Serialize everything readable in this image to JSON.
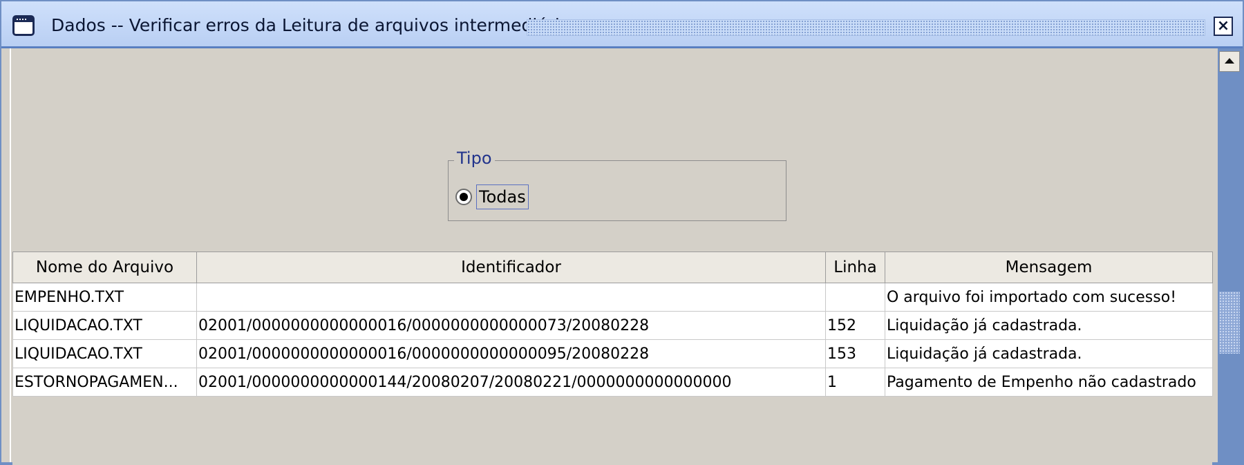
{
  "window": {
    "title": "Dados -- Verificar erros da Leitura de arquivos intermediários",
    "close_glyph": "×"
  },
  "filter": {
    "group_label": "Tipo",
    "option_label": "Todas",
    "selected": true
  },
  "table": {
    "columns": [
      "Nome do Arquivo",
      "Identificador",
      "Linha",
      "Mensagem"
    ],
    "rows": [
      [
        "EMPENHO.TXT",
        "",
        "",
        "O arquivo foi importado com sucesso!"
      ],
      [
        "LIQUIDACAO.TXT",
        "02001/0000000000000016/0000000000000073/20080228",
        "152",
        "Liquidação já cadastrada."
      ],
      [
        "LIQUIDACAO.TXT",
        "02001/0000000000000016/0000000000000095/20080228",
        "153",
        "Liquidação já cadastrada."
      ],
      [
        "ESTORNOPAGAMEN...",
        "02001/0000000000000144/20080207/20080221/0000000000000000",
        "1",
        "Pagamento de Empenho não cadastrado"
      ]
    ]
  }
}
